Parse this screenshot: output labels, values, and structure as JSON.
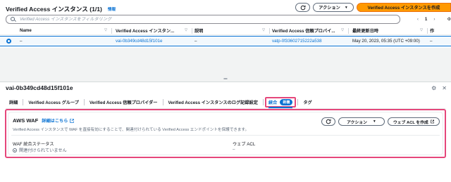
{
  "list": {
    "title": "Verified Access インスタンス (1/1)",
    "info": "情報",
    "refresh_icon": "refresh-icon",
    "actions_label": "アクション",
    "actions_caret": "▼",
    "create_label": "Verified Access インスタンスを作成",
    "search_placeholder": "Verified Access インスタンスをフィルタリング",
    "pager": {
      "prev": "‹",
      "page": "1",
      "next": "›",
      "settings": "⚙"
    },
    "columns": [
      {
        "label": "Name"
      },
      {
        "label": "Verified Access インスタン..."
      },
      {
        "label": "説明"
      },
      {
        "label": "Verified Access 信頼プロバイ..."
      },
      {
        "label": "最終更新日時"
      },
      {
        "label": "作"
      }
    ],
    "sort_arrow": "▽",
    "row": {
      "name": "–",
      "id": "vai-0b349cd48d15f101e",
      "description": "–",
      "trust_provider": "vatp-0f33602715222a538",
      "updated": "May 20, 2023, 05:35 (UTC +09:00)",
      "extra": "–"
    }
  },
  "divider_glyph": "═",
  "detail": {
    "title": "vai-0b349cd48d15f101e",
    "icons": {
      "settings": "⚙",
      "close": "✕"
    },
    "tabs": [
      {
        "label": "詳細"
      },
      {
        "label": "Verified Access グループ"
      },
      {
        "label": "Verified Access 信頼プロバイダー"
      },
      {
        "label": "Verified Access インスタンスのログ記録設定"
      },
      {
        "label": "統合",
        "badge": "新機"
      },
      {
        "label": "タグ"
      }
    ],
    "waf": {
      "title": "AWS WAF",
      "link": "詳細はこちら",
      "description": "Verified Access インスタンスで WAF を直接有効にすることで、関連付けられている Verified Access エンドポイントを保護できます。",
      "refresh_icon": "refresh-icon",
      "actions_label": "アクション",
      "actions_caret": "▼",
      "web_acl_create_label": "ウェブ ACL を作成",
      "status_label": "WAF 統合ステータス",
      "status_value": "関連付けられていません",
      "acl_label": "ウェブ ACL",
      "acl_value": "–"
    }
  },
  "colors": {
    "accent": "#0972d3",
    "primary": "#ff9900",
    "highlight": "#e5477b"
  }
}
